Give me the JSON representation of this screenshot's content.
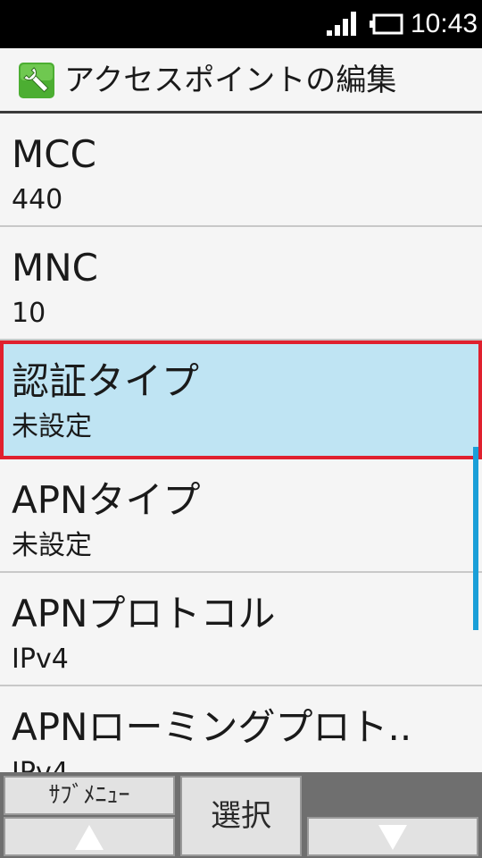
{
  "status_bar": {
    "time": "10:43",
    "icons": [
      "signal-icon",
      "battery-icon"
    ]
  },
  "header": {
    "icon": "wrench-icon",
    "title": "アクセスポイントの編集"
  },
  "list": {
    "items": [
      {
        "title": "MCC",
        "value": "440",
        "selected": false
      },
      {
        "title": "MNC",
        "value": "10",
        "selected": false
      },
      {
        "title": "認証タイプ",
        "value": "未設定",
        "selected": true
      },
      {
        "title": "APNタイプ",
        "value": "未設定",
        "selected": false
      },
      {
        "title": "APNプロトコル",
        "value": "IPv4",
        "selected": false
      },
      {
        "title": "APNローミングプロト..",
        "value": "IPv4",
        "selected": false
      }
    ]
  },
  "softkeys": {
    "submenu_label": "ｻﾌﾞﾒﾆｭｰ",
    "select_label": "選択",
    "up_icon": "up-arrow-icon",
    "down_icon": "down-arrow-icon"
  },
  "colors": {
    "selected_background": "#bfe4f3",
    "selected_border": "#e0202e",
    "scrollbar": "#1a9fd8",
    "softkey_bar": "#6f6f6f"
  }
}
